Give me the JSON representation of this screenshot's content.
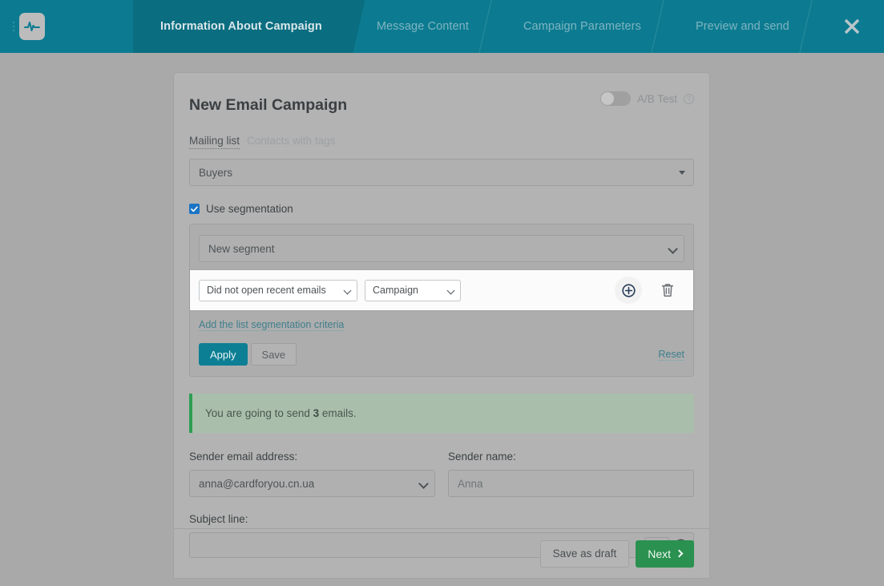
{
  "topbar": {
    "logo_icon": "pulse-activity-icon",
    "drag_handle_icon": "drag-dots-icon",
    "close_icon": "close-x-icon",
    "tabs": [
      {
        "label": "Information About Campaign",
        "active": true
      },
      {
        "label": "Message Content",
        "active": false
      },
      {
        "label": "Campaign Parameters",
        "active": false
      },
      {
        "label": "Preview and send",
        "active": false
      }
    ],
    "accent_color": "#0c7b91",
    "active_tab_color": "#0a6d80"
  },
  "card": {
    "title": "New Email Campaign",
    "ab_test": {
      "label": "A/B Test",
      "enabled": false,
      "help_icon": "question-circle-icon",
      "help_glyph": "?"
    },
    "list_tabs": [
      {
        "label": "Mailing list",
        "active": true
      },
      {
        "label": "Contacts with tags",
        "active": false
      }
    ],
    "mailing_list": {
      "value": "Buyers",
      "options": [
        "Buyers"
      ]
    },
    "segmentation": {
      "checkbox_label": "Use segmentation",
      "checked": true,
      "segment_select": {
        "value": "New segment",
        "options": [
          "New segment"
        ]
      },
      "criteria": [
        {
          "condition": {
            "value": "Did not open recent emails",
            "options": [
              "Did not open recent emails"
            ]
          },
          "target": {
            "value": "Campaign",
            "options": [
              "Campaign"
            ]
          },
          "add_icon": "plus-circle-icon",
          "delete_icon": "trash-icon"
        }
      ],
      "add_criteria_link": "Add the list segmentation criteria",
      "apply_label": "Apply",
      "save_label": "Save",
      "reset_label": "Reset",
      "apply_color": "#0d7f94"
    },
    "alert": {
      "text_before": "You are going to send ",
      "count": "3",
      "text_after": " emails.",
      "accent_color": "#2e9e53"
    },
    "sender_email": {
      "label": "Sender email address:",
      "value": "anna@cardforyou.cn.ua",
      "options": [
        "anna@cardforyou.cn.ua"
      ]
    },
    "sender_name": {
      "label": "Sender name:",
      "value": "",
      "placeholder": "Anna"
    },
    "subject": {
      "label": "Subject line:",
      "value": "",
      "placeholder": "",
      "merge_tag_button": "{}",
      "merge_tag_icon": "merge-tag-icon",
      "emoji_icon": "emoji-smiley-icon"
    },
    "footer": {
      "save_draft_label": "Save as draft",
      "next_label": "Next",
      "next_icon": "chevron-right-icon",
      "next_color": "#2a9150"
    }
  }
}
